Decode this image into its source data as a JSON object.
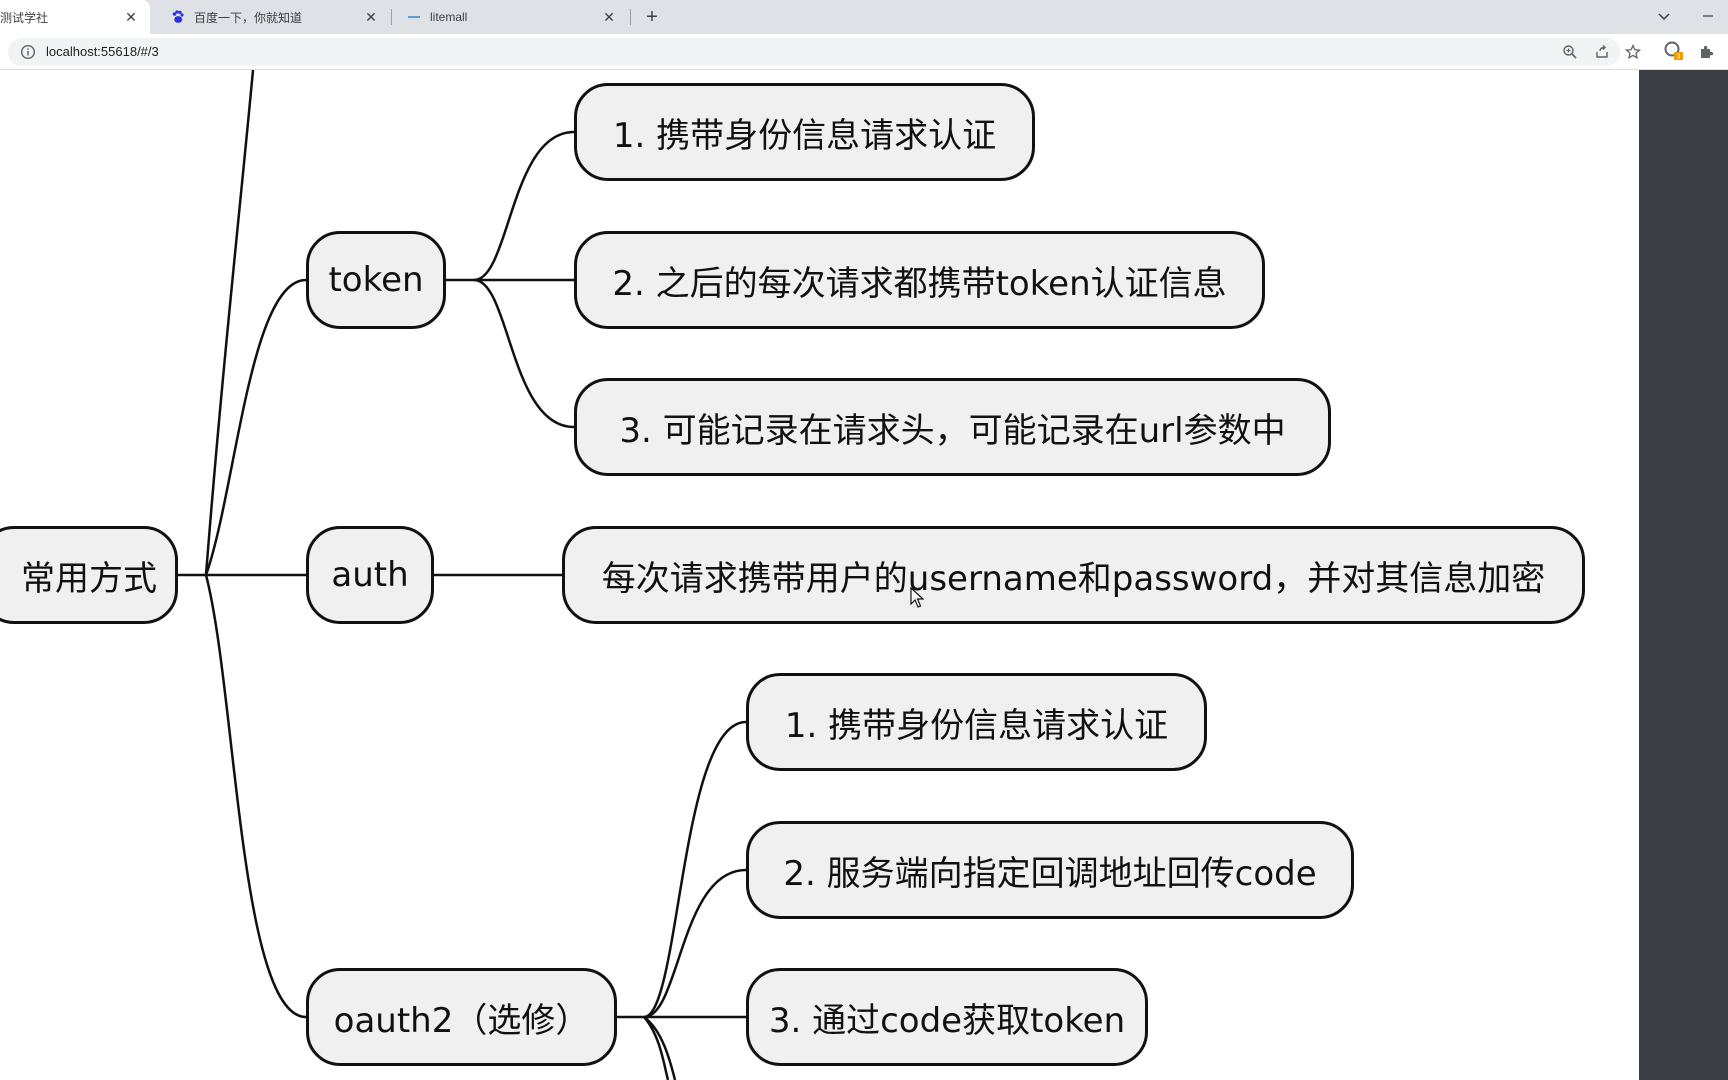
{
  "browser": {
    "tabs": [
      {
        "title": "测试学社",
        "close": "✕",
        "active": true
      },
      {
        "title": "百度一下，你就知道",
        "close": "✕",
        "active": false
      },
      {
        "title": "litemall",
        "close": "✕",
        "active": false
      }
    ],
    "new_tab": "+",
    "url": "localhost:55618/#/3",
    "extension_badge": "3"
  },
  "mindmap": {
    "root": "常用方式",
    "branches": [
      {
        "label": "token",
        "children": [
          "1. 携带身份信息请求认证",
          "2. 之后的每次请求都携带token认证信息",
          "3. 可能记录在请求头，可能记录在url参数中"
        ]
      },
      {
        "label": "auth",
        "children": [
          "每次请求携带用户的username和password，并对其信息加密"
        ]
      },
      {
        "label": "oauth2（选修）",
        "children": [
          "1. 携带身份信息请求认证",
          "2. 服务端向指定回调地址回传code",
          "3. 通过code获取token"
        ]
      }
    ]
  },
  "colors": {
    "node_fill": "#f0f0f0",
    "node_border": "#111111",
    "side_panel": "#3b3e42",
    "tabstrip": "#dee1e6"
  }
}
